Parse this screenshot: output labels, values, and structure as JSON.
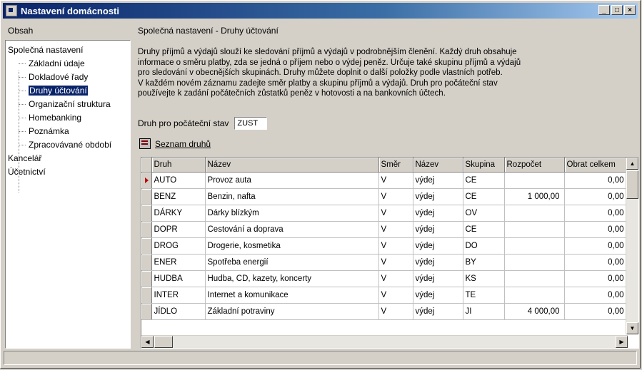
{
  "window": {
    "title": "Nastavení domácnosti",
    "buttons": [
      "_",
      "□",
      "×"
    ]
  },
  "left_panel": {
    "header": "Obsah",
    "tree": [
      {
        "label": "Společná nastavení",
        "level": 0
      },
      {
        "label": "Základní údaje",
        "level": 1
      },
      {
        "label": "Dokladové řady",
        "level": 1
      },
      {
        "label": "Druhy účtování",
        "level": 1,
        "selected": true
      },
      {
        "label": "Organizační struktura",
        "level": 1
      },
      {
        "label": "Homebanking",
        "level": 1
      },
      {
        "label": "Poznámka",
        "level": 1
      },
      {
        "label": "Zpracovávané období",
        "level": 1
      },
      {
        "label": "Kancelář",
        "level": 0
      },
      {
        "label": "Účetnictví",
        "level": 0
      }
    ]
  },
  "right_panel": {
    "header": "Společná nastavení - Druhy účtování",
    "description": [
      "Druhy příjmů a výdajů slouží ke sledování příjmů a výdajů v podrobnějším členění. Každý druh obsahuje",
      "informace o směru platby, zda se jedná o příjem nebo o výdej peněz. Určuje také skupinu příjmů a výdajů",
      "pro sledování v obecnějších skupinách. Druhy můžete doplnit o další položky podle vlastních potřeb.",
      "V každém novém záznamu zadejte směr platby a skupinu příjmů a výdajů. Druh pro počáteční stav",
      "používejte k zadání počátečních zůstatků peněz v hotovosti a na bankovních účtech."
    ],
    "druh_label": "Druh pro počáteční stav",
    "druh_value": "ZUST",
    "seznam_label": "Seznam druhů"
  },
  "grid": {
    "columns": [
      "Druh",
      "Název",
      "Směr",
      "Název",
      "Skupina",
      "Rozpočet",
      "Obrat celkem"
    ],
    "rows": [
      [
        "AUTO",
        "Provoz auta",
        "V",
        "výdej",
        "CE",
        "",
        "0,00"
      ],
      [
        "BENZ",
        "Benzin, nafta",
        "V",
        "výdej",
        "CE",
        "1 000,00",
        "0,00"
      ],
      [
        "DÁRKY",
        "Dárky blízkým",
        "V",
        "výdej",
        "OV",
        "",
        "0,00"
      ],
      [
        "DOPR",
        "Cestování a doprava",
        "V",
        "výdej",
        "CE",
        "",
        "0,00"
      ],
      [
        "DROG",
        "Drogerie, kosmetika",
        "V",
        "výdej",
        "DO",
        "",
        "0,00"
      ],
      [
        "ENER",
        "Spotřeba energií",
        "V",
        "výdej",
        "BY",
        "",
        "0,00"
      ],
      [
        "HUDBA",
        "Hudba, CD, kazety, koncerty",
        "V",
        "výdej",
        "KS",
        "",
        "0,00"
      ],
      [
        "INTER",
        "Internet a komunikace",
        "V",
        "výdej",
        "TE",
        "",
        "0,00"
      ],
      [
        "JÍDLO",
        "Základní potraviny",
        "V",
        "výdej",
        "JI",
        "4 000,00",
        "0,00"
      ]
    ],
    "current_row": 0
  }
}
